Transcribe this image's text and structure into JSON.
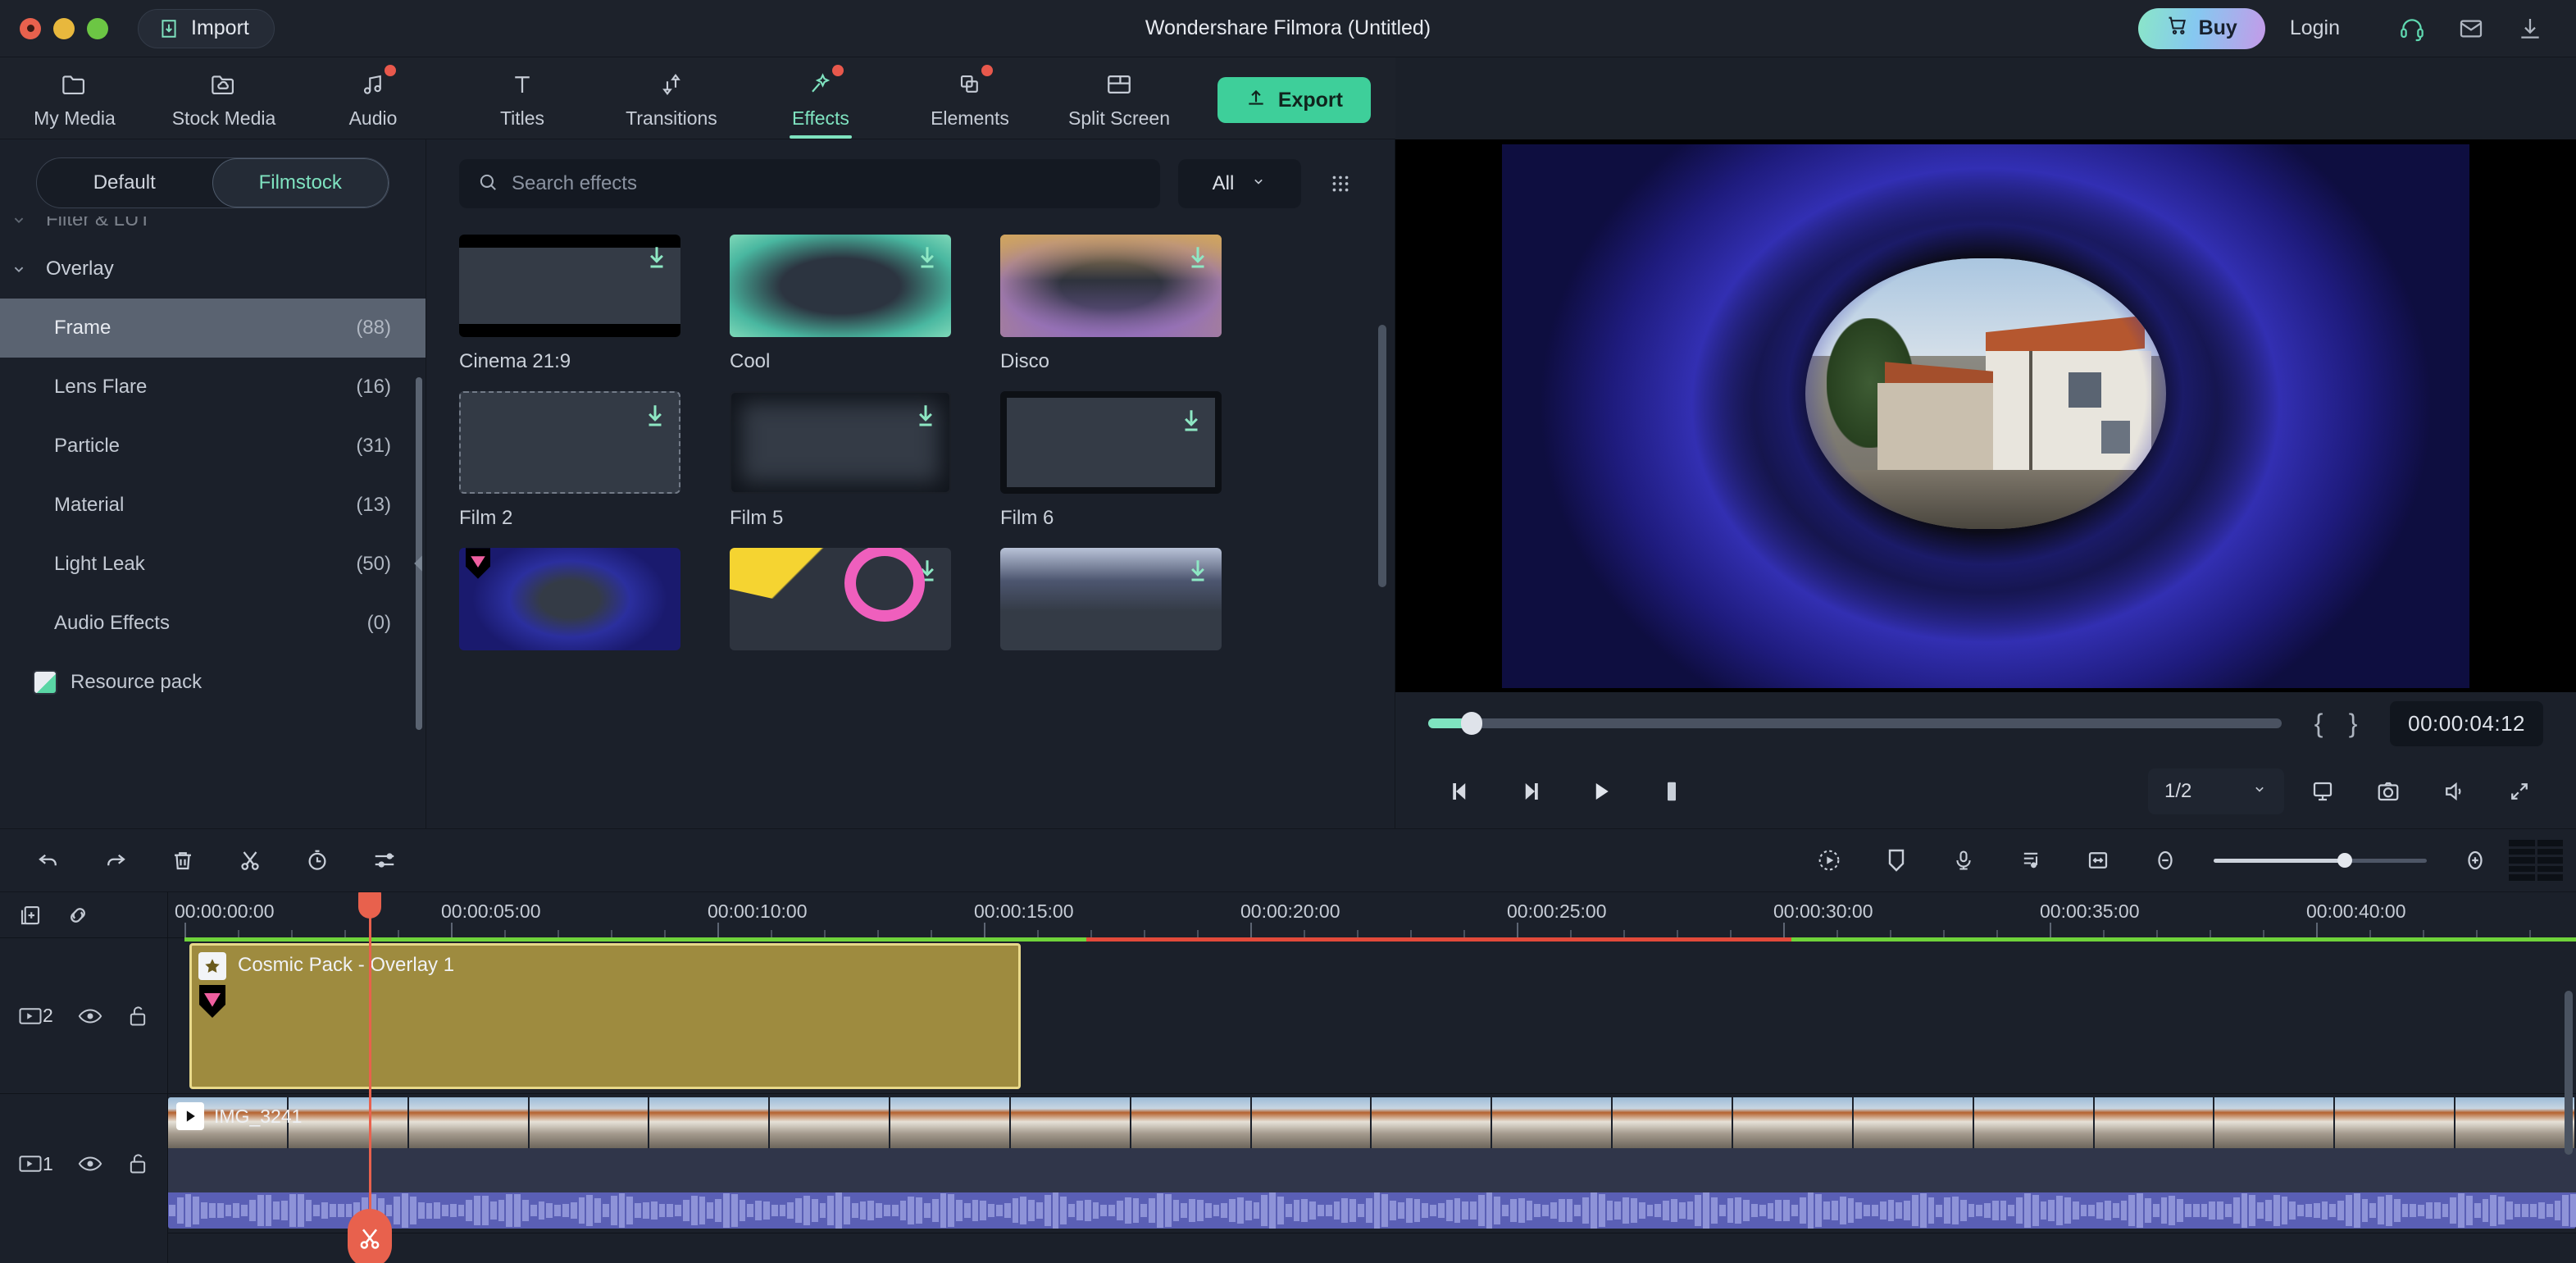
{
  "titlebar": {
    "import_label": "Import",
    "window_title": "Wondershare Filmora (Untitled)",
    "buy_label": "Buy",
    "login_label": "Login",
    "icons": [
      "headset-icon",
      "mail-icon",
      "download-icon"
    ]
  },
  "toolbar": {
    "tabs": [
      {
        "label": "My Media",
        "icon": "folder-icon",
        "active": false,
        "badge": false
      },
      {
        "label": "Stock Media",
        "icon": "cloud-folder-icon",
        "active": false,
        "badge": false
      },
      {
        "label": "Audio",
        "icon": "music-note-icon",
        "active": false,
        "badge": true
      },
      {
        "label": "Titles",
        "icon": "text-t-icon",
        "active": false,
        "badge": false
      },
      {
        "label": "Transitions",
        "icon": "transition-icon",
        "active": false,
        "badge": false
      },
      {
        "label": "Effects",
        "icon": "magic-wand-icon",
        "active": true,
        "badge": true
      },
      {
        "label": "Elements",
        "icon": "layers-icon",
        "active": false,
        "badge": true
      },
      {
        "label": "Split Screen",
        "icon": "split-screen-icon",
        "active": false,
        "badge": false
      }
    ],
    "export_label": "Export"
  },
  "sidebar": {
    "segments": [
      {
        "label": "Default",
        "active": false
      },
      {
        "label": "Filmstock",
        "active": true
      }
    ],
    "categories": [
      {
        "label": "Filter & LUT",
        "count": "",
        "type": "group",
        "selected": false,
        "clipped": true
      },
      {
        "label": "Overlay",
        "count": "",
        "type": "group",
        "selected": false,
        "clipped": false
      },
      {
        "label": "Frame",
        "count": "(88)",
        "type": "child",
        "selected": true,
        "clipped": false
      },
      {
        "label": "Lens Flare",
        "count": "(16)",
        "type": "child",
        "selected": false,
        "clipped": false
      },
      {
        "label": "Particle",
        "count": "(31)",
        "type": "child",
        "selected": false,
        "clipped": false
      },
      {
        "label": "Material",
        "count": "(13)",
        "type": "child",
        "selected": false,
        "clipped": false
      },
      {
        "label": "Light Leak",
        "count": "(50)",
        "type": "child",
        "selected": false,
        "clipped": false
      },
      {
        "label": "Audio Effects",
        "count": "(0)",
        "type": "child",
        "selected": false,
        "clipped": false
      }
    ],
    "resource_pack_label": "Resource pack"
  },
  "browser": {
    "search_placeholder": "Search effects",
    "search_value": "",
    "filter_label": "All",
    "effects": [
      {
        "name": "Cinema 21:9",
        "thumb": "t-cinema",
        "download": true,
        "pro": false
      },
      {
        "name": "Cool",
        "thumb": "t-cool",
        "download": true,
        "pro": false
      },
      {
        "name": "Disco",
        "thumb": "t-disco",
        "download": true,
        "pro": false
      },
      {
        "name": "Film 2",
        "thumb": "t-film2",
        "download": true,
        "pro": false
      },
      {
        "name": "Film 5",
        "thumb": "t-film5",
        "download": true,
        "pro": false
      },
      {
        "name": "Film 6",
        "thumb": "t-film6",
        "download": true,
        "pro": false
      },
      {
        "name": "",
        "thumb": "t-cosmic",
        "download": false,
        "pro": true
      },
      {
        "name": "",
        "thumb": "t-neon",
        "download": true,
        "pro": false
      },
      {
        "name": "",
        "thumb": "t-snow",
        "download": true,
        "pro": false
      }
    ]
  },
  "preview": {
    "timecode": "00:00:04:12",
    "mark_in": "{",
    "mark_out": "}",
    "quality_label": "1/2",
    "controls": [
      {
        "name": "prev-frame-button",
        "icon": "prev-frame-icon"
      },
      {
        "name": "next-frame-button",
        "icon": "next-frame-icon"
      },
      {
        "name": "play-button",
        "icon": "play-icon"
      },
      {
        "name": "stop-button",
        "icon": "stop-icon"
      }
    ],
    "right_icons": [
      "cast-icon",
      "snapshot-icon",
      "volume-icon",
      "fullscreen-icon"
    ]
  },
  "timeline": {
    "toolbar_left_icons": [
      "undo-icon",
      "redo-icon",
      "delete-icon",
      "split-scissors-icon",
      "speed-clock-icon",
      "settings-sliders-icon"
    ],
    "toolbar_right_icons": [
      "marker-record-icon",
      "marker-icon",
      "voiceover-mic-icon",
      "audio-mixer-icon",
      "fit-timeline-icon",
      "zoom-out-icon",
      "zoom-in-icon",
      "render-preview-icon"
    ],
    "head_icons": [
      "add-track-icon",
      "link-icon"
    ],
    "ruler_labels": [
      "00:00:00:00",
      "00:00:05:00",
      "00:00:10:00",
      "00:00:15:00",
      "00:00:20:00",
      "00:00:25:00",
      "00:00:30:00",
      "00:00:35:00",
      "00:00:40:00"
    ],
    "tracks": [
      {
        "number": "2",
        "visible_icon": "eye-icon",
        "lock_icon": "unlock-icon"
      },
      {
        "number": "1",
        "visible_icon": "eye-icon",
        "lock_icon": "unlock-icon"
      }
    ],
    "clips": [
      {
        "title": "Cosmic Pack - Overlay 1",
        "track": 2,
        "type": "overlay",
        "badge": "pro-gem-icon"
      },
      {
        "title": "IMG_3241",
        "track": 1,
        "type": "video",
        "badge": "play-icon"
      }
    ],
    "playhead_time": "00:00:04:12"
  },
  "colors": {
    "accent_teal": "#7fe3c0",
    "export_green": "#3ecf9a",
    "playhead_red": "#e8614d",
    "clip_overlay": "#9e8b3f",
    "clip_overlay_border": "#e8d98a",
    "audio_purple": "#5a5fb5",
    "render_green": "#6fd33a",
    "render_red": "#e24a3a",
    "panel_bg": "#1b202a",
    "titlebar_bg": "#1d222b"
  }
}
